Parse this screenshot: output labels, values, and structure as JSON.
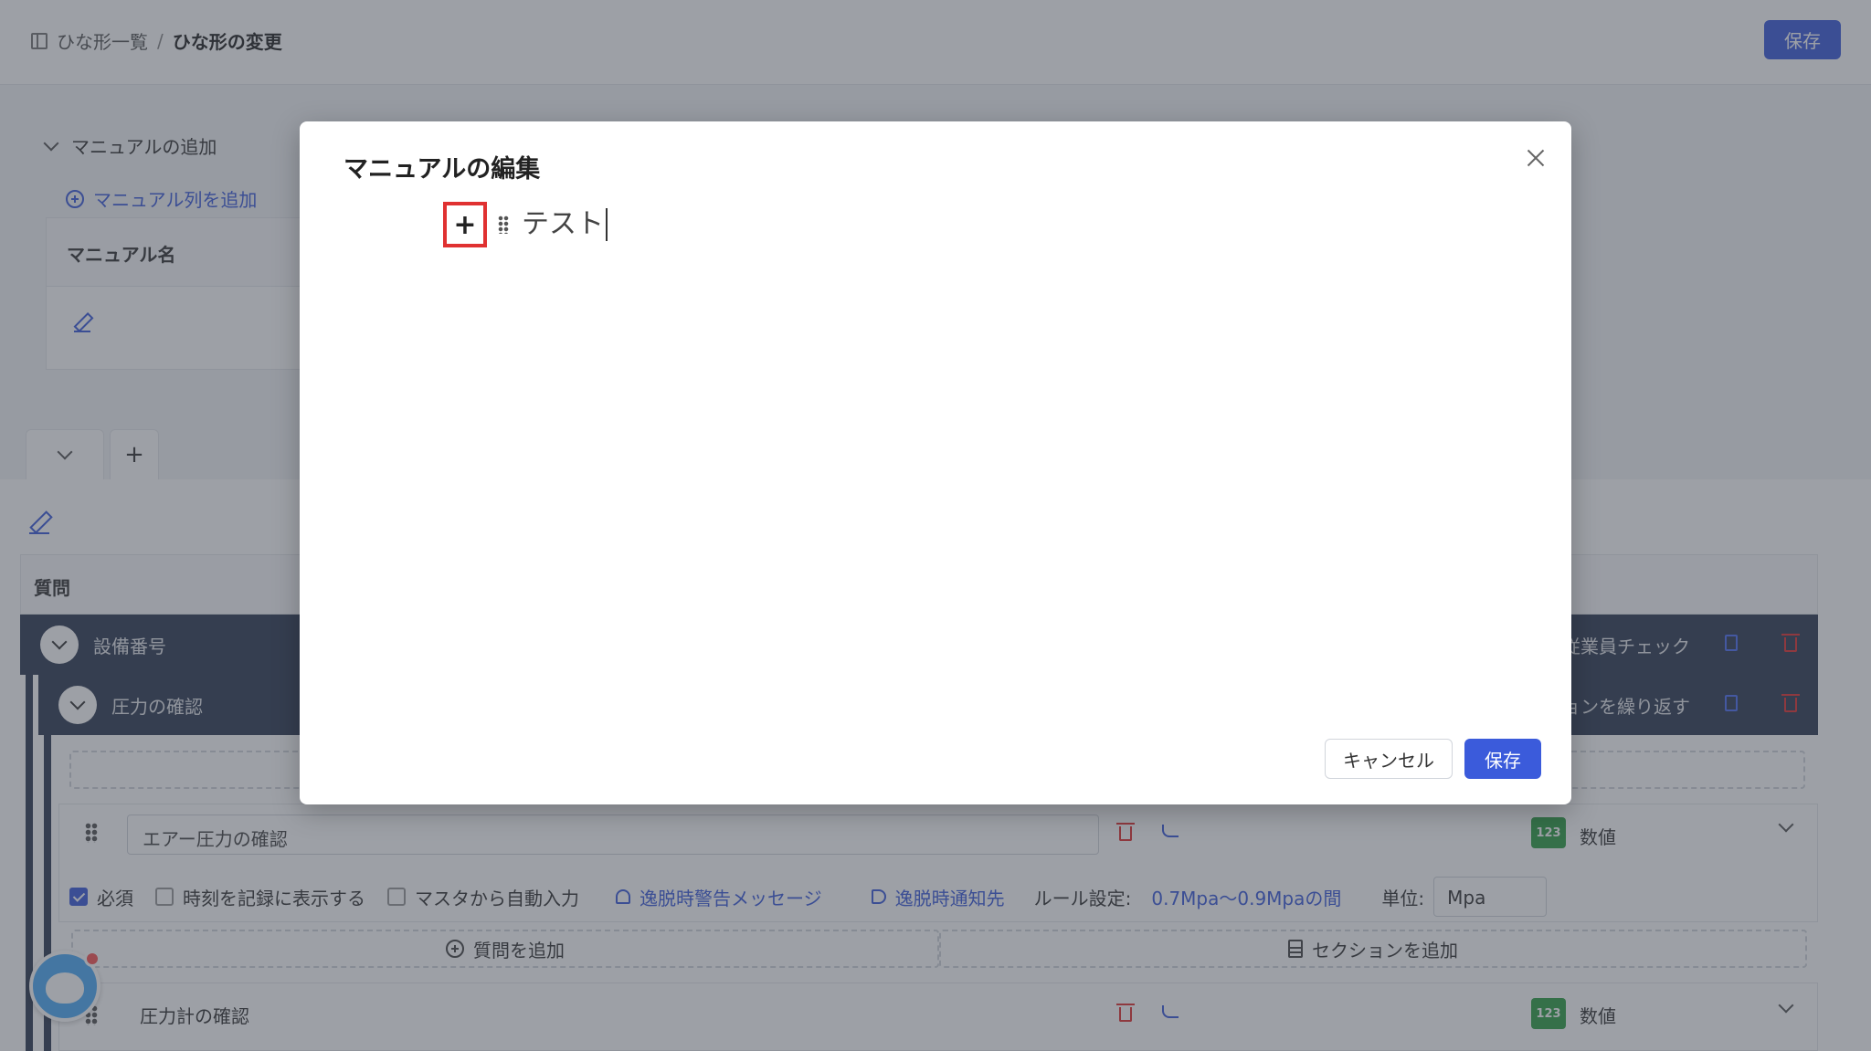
{
  "header": {
    "breadcrumb_root": "ひな形一覧",
    "breadcrumb_sep": "/",
    "breadcrumb_current": "ひな形の変更",
    "save_label": "保存"
  },
  "manual": {
    "section_label": "マニュアルの追加",
    "add_column_label": "マニュアル列を追加",
    "column_header": "マニュアル名"
  },
  "tabs": {
    "add_label": "+"
  },
  "questions": {
    "header": "質問",
    "section1": {
      "title": "設備番号",
      "right_text": "従業員チェック"
    },
    "section2": {
      "title": "圧力の確認",
      "right_text": "ョンを繰り返す"
    },
    "q1": {
      "value": "エアー圧力の確認",
      "type_badge": "123",
      "type_label": "数値"
    },
    "options": {
      "required": "必須",
      "show_time": "時刻を記録に表示する",
      "auto_fill": "マスタから自動入力",
      "warning_msg": "逸脱時警告メッセージ",
      "notify": "逸脱時通知先",
      "rule_label": "ルール設定:",
      "rule_value": "0.7Mpa〜0.9Mpaの間",
      "unit_label": "単位:",
      "unit_value": "Mpa"
    },
    "add_question": "質問を追加",
    "add_section": "セクションを追加",
    "q2": {
      "value": "圧力計の確認",
      "type_badge": "123",
      "type_label": "数値"
    }
  },
  "modal": {
    "title": "マニュアルの編集",
    "plus_label": "+",
    "editor_text": "テスト",
    "cancel_label": "キャンセル",
    "save_label": "保存"
  }
}
